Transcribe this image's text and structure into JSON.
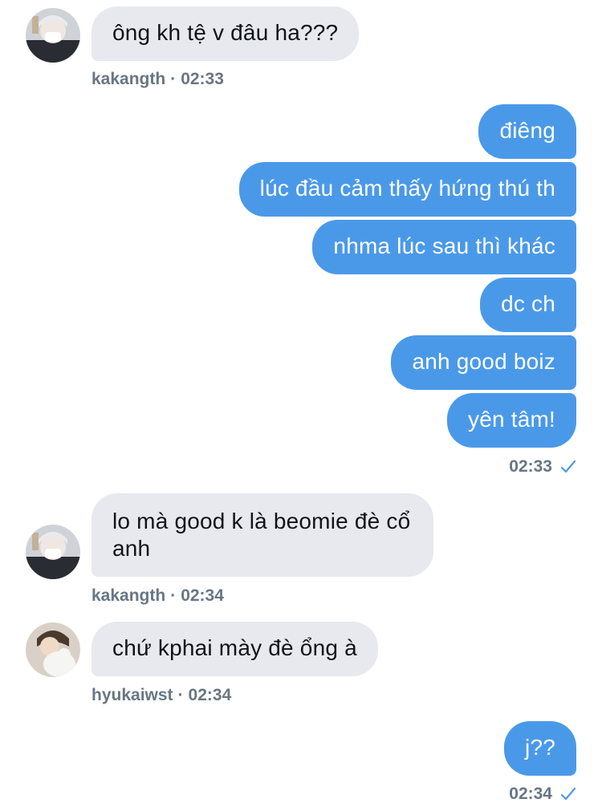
{
  "conversation": {
    "messages": [
      {
        "sender": "kakangth",
        "direction": "incoming",
        "text": "ông kh tệ v đâu ha???",
        "time": "02:33"
      },
      {
        "direction": "outgoing",
        "text": "điêng"
      },
      {
        "direction": "outgoing",
        "text": "lúc đầu cảm thấy hứng thú th"
      },
      {
        "direction": "outgoing",
        "text": "nhma lúc sau thì khác"
      },
      {
        "direction": "outgoing",
        "text": "dc ch"
      },
      {
        "direction": "outgoing",
        "text": "anh good boiz"
      },
      {
        "direction": "outgoing",
        "text": "yên tâm!",
        "time": "02:33"
      },
      {
        "sender": "kakangth",
        "direction": "incoming",
        "text": "lo mà good k là beomie đè cổ anh",
        "time": "02:34"
      },
      {
        "sender": "hyukaiwst",
        "direction": "incoming",
        "text": "chứ kphai mày đè ổng à",
        "time": "02:34"
      },
      {
        "direction": "outgoing",
        "text": "j??",
        "time": "02:34"
      }
    ],
    "separator": "·",
    "read_icon": "check-icon",
    "colors": {
      "outgoing_bubble": "#4a99e9",
      "incoming_bubble": "#e7e9ef",
      "meta_text": "#687684",
      "read_check": "#4a99e9"
    }
  }
}
